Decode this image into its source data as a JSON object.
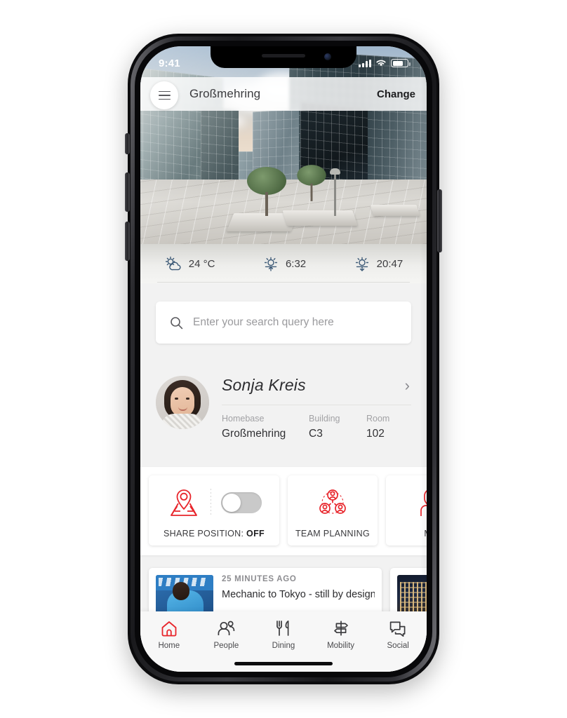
{
  "status_bar": {
    "time": "9:41",
    "signal_icon": "cellular-signal-icon",
    "wifi_icon": "wifi-icon",
    "battery_icon": "battery-icon"
  },
  "header": {
    "menu_icon": "hamburger-menu-icon",
    "location": "Großmehring",
    "change_label": "Change"
  },
  "hero": {
    "alt": "modern glass office campus plaza at sunset"
  },
  "weather": {
    "items": [
      {
        "icon": "partly-cloudy-icon",
        "value": "24 °C"
      },
      {
        "icon": "sunrise-icon",
        "value": "6:32"
      },
      {
        "icon": "sunset-icon",
        "value": "20:47"
      }
    ]
  },
  "search": {
    "icon": "search-icon",
    "placeholder": "Enter your search query here",
    "value": ""
  },
  "profile": {
    "avatar_icon": "user-avatar-photo",
    "name": "Sonja Kreis",
    "chevron_icon": "chevron-right-icon",
    "fields": [
      {
        "label": "Homebase",
        "value": "Großmehring"
      },
      {
        "label": "Building",
        "value": "C3"
      },
      {
        "label": "Room",
        "value": "102"
      }
    ]
  },
  "quick_actions": [
    {
      "id": "share-position",
      "icon": "map-pin-icon",
      "label_prefix": "SHARE POSITION: ",
      "label_state": "OFF",
      "toggle_state": "off"
    },
    {
      "id": "team-planning",
      "icon": "team-group-icon",
      "label": "TEAM PLANNING"
    },
    {
      "id": "my-visitors",
      "icon": "visitor-person-icon",
      "label": "MY"
    }
  ],
  "news": [
    {
      "time": "25 MINUTES AGO",
      "title": "Mechanic to Tokyo - still by design",
      "thumb_icon": "news-photo-athlete"
    },
    {
      "time": "",
      "title": "",
      "thumb_icon": "news-photo-night-city"
    }
  ],
  "tabbar": {
    "items": [
      {
        "id": "home",
        "icon": "home-icon",
        "label": "Home",
        "active": true
      },
      {
        "id": "people",
        "icon": "people-icon",
        "label": "People",
        "active": false
      },
      {
        "id": "dining",
        "icon": "dining-icon",
        "label": "Dining",
        "active": false
      },
      {
        "id": "mobility",
        "icon": "mobility-signpost-icon",
        "label": "Mobility",
        "active": false
      },
      {
        "id": "social",
        "icon": "social-chat-icon",
        "label": "Social",
        "active": false
      }
    ]
  },
  "colors": {
    "accent_red": "#e8252b",
    "weather_icon": "#3d5a77",
    "text_dark": "#2d2d30",
    "text_muted": "#9a9a9d",
    "toggle_off": "#c9c9c9"
  }
}
